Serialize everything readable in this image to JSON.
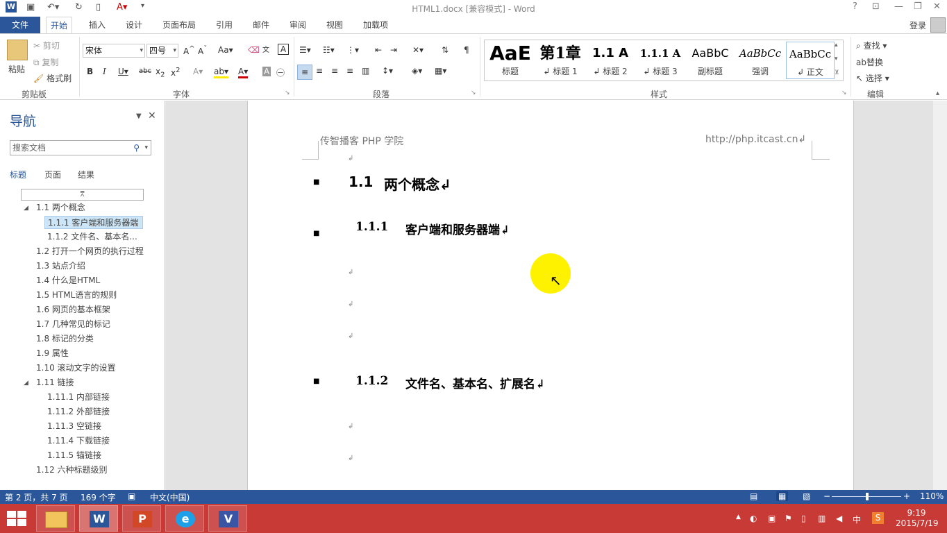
{
  "window": {
    "title": "HTML1.docx [兼容模式] - Word",
    "login": "登录"
  },
  "tabs": [
    "文件",
    "开始",
    "插入",
    "设计",
    "页面布局",
    "引用",
    "邮件",
    "审阅",
    "视图",
    "加载项"
  ],
  "active_tab": "开始",
  "ribbon": {
    "clipboard": {
      "paste": "粘贴",
      "cut": "剪切",
      "copy": "复制",
      "format_painter": "格式刷",
      "label": "剪贴板"
    },
    "font": {
      "name": "宋体",
      "size": "四号",
      "label": "字体",
      "case_btn": "Aa"
    },
    "paragraph": {
      "label": "段落"
    },
    "styles": {
      "label": "样式",
      "items": [
        {
          "preview": "AaE",
          "name": "标题"
        },
        {
          "preview": "第1章",
          "name": "↲ 标题 1"
        },
        {
          "preview": "1.1 A",
          "name": "↲ 标题 2"
        },
        {
          "preview": "1.1.1 A",
          "name": "↲ 标题 3"
        },
        {
          "preview": "AaBbC",
          "name": "副标题"
        },
        {
          "preview": "AaBbCc",
          "name": "强调"
        },
        {
          "preview": "AaBbCc",
          "name": "↲ 正文"
        }
      ]
    },
    "editing": {
      "find": "查找",
      "replace": "替换",
      "select": "选择",
      "label": "编辑"
    }
  },
  "nav": {
    "title": "导航",
    "search_placeholder": "搜索文档",
    "tabs": [
      "标题",
      "页面",
      "结果"
    ],
    "items": [
      {
        "text": "1.1 两个概念",
        "level": 1,
        "expanded": true
      },
      {
        "text": "1.1.1 客户端和服务器端",
        "level": 2,
        "selected": true
      },
      {
        "text": "1.1.2 文件名、基本名...",
        "level": 2
      },
      {
        "text": "1.2 打开一个网页的执行过程",
        "level": 1
      },
      {
        "text": "1.3 站点介绍",
        "level": 1
      },
      {
        "text": "1.4 什么是HTML",
        "level": 1
      },
      {
        "text": "1.5 HTML语言的规则",
        "level": 1
      },
      {
        "text": "1.6 网页的基本框架",
        "level": 1
      },
      {
        "text": "1.7 几种常见的标记",
        "level": 1
      },
      {
        "text": "1.8 标记的分类",
        "level": 1
      },
      {
        "text": "1.9 属性",
        "level": 1
      },
      {
        "text": "1.10 滚动文字的设置",
        "level": 1
      },
      {
        "text": "1.11 链接",
        "level": 1,
        "expanded": true
      },
      {
        "text": "1.11.1 内部链接",
        "level": 2
      },
      {
        "text": "1.11.2 外部链接",
        "level": 2
      },
      {
        "text": "1.11.3 空链接",
        "level": 2
      },
      {
        "text": "1.11.4 下载链接",
        "level": 2
      },
      {
        "text": "1.11.5 锚链接",
        "level": 2
      },
      {
        "text": "1.12 六种标题级别",
        "level": 1
      }
    ]
  },
  "document": {
    "header_left": "传智播客 PHP 学院",
    "header_right": "http://php.itcast.cn↲",
    "h2_num": "1.1",
    "h2_text": "两个概念↲",
    "h3a_num": "1.1.1",
    "h3a_text": "客户端和服务器端↲",
    "h3b_num": "1.1.2",
    "h3b_text": "文件名、基本名、扩展名↲",
    "para_mark": "↲"
  },
  "status": {
    "page": "第 2 页，共 7 页",
    "words": "169 个字",
    "language": "中文(中国)",
    "zoom": "110%",
    "zoom_level_percent": 110
  },
  "taskbar": {
    "apps": [
      "explorer-icon",
      "word-icon",
      "powerpoint-icon",
      "ie-icon",
      "visio-icon"
    ],
    "ime": "中",
    "time": "9:19",
    "date": "2015/7/19"
  }
}
